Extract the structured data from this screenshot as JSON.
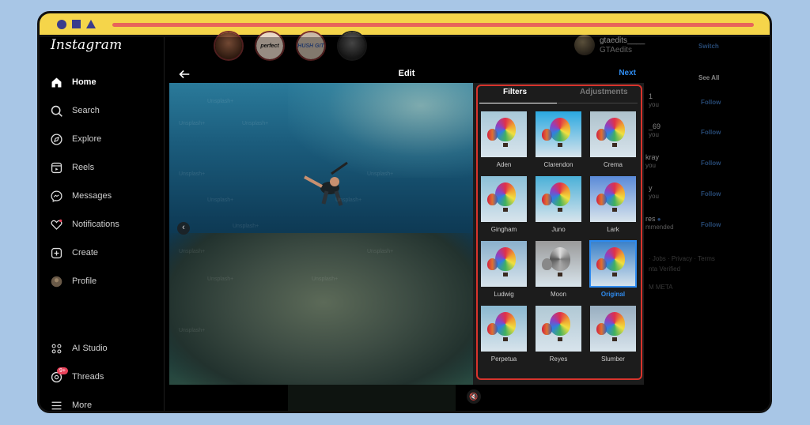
{
  "app": {
    "logo": "Instagram"
  },
  "sidebar": {
    "items": [
      {
        "label": "Home",
        "icon": "home-icon"
      },
      {
        "label": "Search",
        "icon": "search-icon"
      },
      {
        "label": "Explore",
        "icon": "compass-icon"
      },
      {
        "label": "Reels",
        "icon": "reels-icon"
      },
      {
        "label": "Messages",
        "icon": "messenger-icon"
      },
      {
        "label": "Notifications",
        "icon": "heart-icon"
      },
      {
        "label": "Create",
        "icon": "plus-square-icon"
      },
      {
        "label": "Profile",
        "icon": "avatar-icon"
      },
      {
        "label": "AI Studio",
        "icon": "ai-studio-icon"
      },
      {
        "label": "Threads",
        "icon": "threads-icon",
        "badge": "9+"
      },
      {
        "label": "More",
        "icon": "menu-icon"
      }
    ]
  },
  "stories": [
    {
      "text": ""
    },
    {
      "text": "perfect"
    },
    {
      "text": "HUSH GIT"
    },
    {
      "text": ""
    }
  ],
  "right": {
    "username": "gtaedits____",
    "fullname": "GTAedits",
    "switch": "Switch",
    "see_all": "See All",
    "follow": "Follow",
    "frag1": "1",
    "frag1b": "you",
    "frag2": "_69",
    "frag2b": "you",
    "frag3": "kray",
    "frag3b": "you",
    "frag4": "y",
    "frag4b": "you",
    "frag5": "res",
    "frag5b": "mmended",
    "footer1": "· Jobs · Privacy · Terms",
    "footer2": "nta Verified",
    "footer3": "M META"
  },
  "modal": {
    "title": "Edit",
    "next": "Next",
    "tabs": {
      "filters": "Filters",
      "adjustments": "Adjustments"
    },
    "filters": [
      {
        "name": "Aden",
        "sky": "#a8c8d8"
      },
      {
        "name": "Clarendon",
        "sky": "#2aa8e0"
      },
      {
        "name": "Crema",
        "sky": "#aec2cc"
      },
      {
        "name": "Gingham",
        "sky": "#8cc0d8"
      },
      {
        "name": "Juno",
        "sky": "#4ab0d8"
      },
      {
        "name": "Lark",
        "sky": "#5a8ad8"
      },
      {
        "name": "Ludwig",
        "sky": "#8ab0cc"
      },
      {
        "name": "Moon",
        "sky": "#9a9a9a"
      },
      {
        "name": "Original",
        "sky": "#3a80c8",
        "selected": true
      },
      {
        "name": "Perpetua",
        "sky": "#8ab8d0"
      },
      {
        "name": "Reyes",
        "sky": "#b0c8d4"
      },
      {
        "name": "Slumber",
        "sky": "#98aec0"
      }
    ],
    "watermark": "Unsplash+"
  }
}
